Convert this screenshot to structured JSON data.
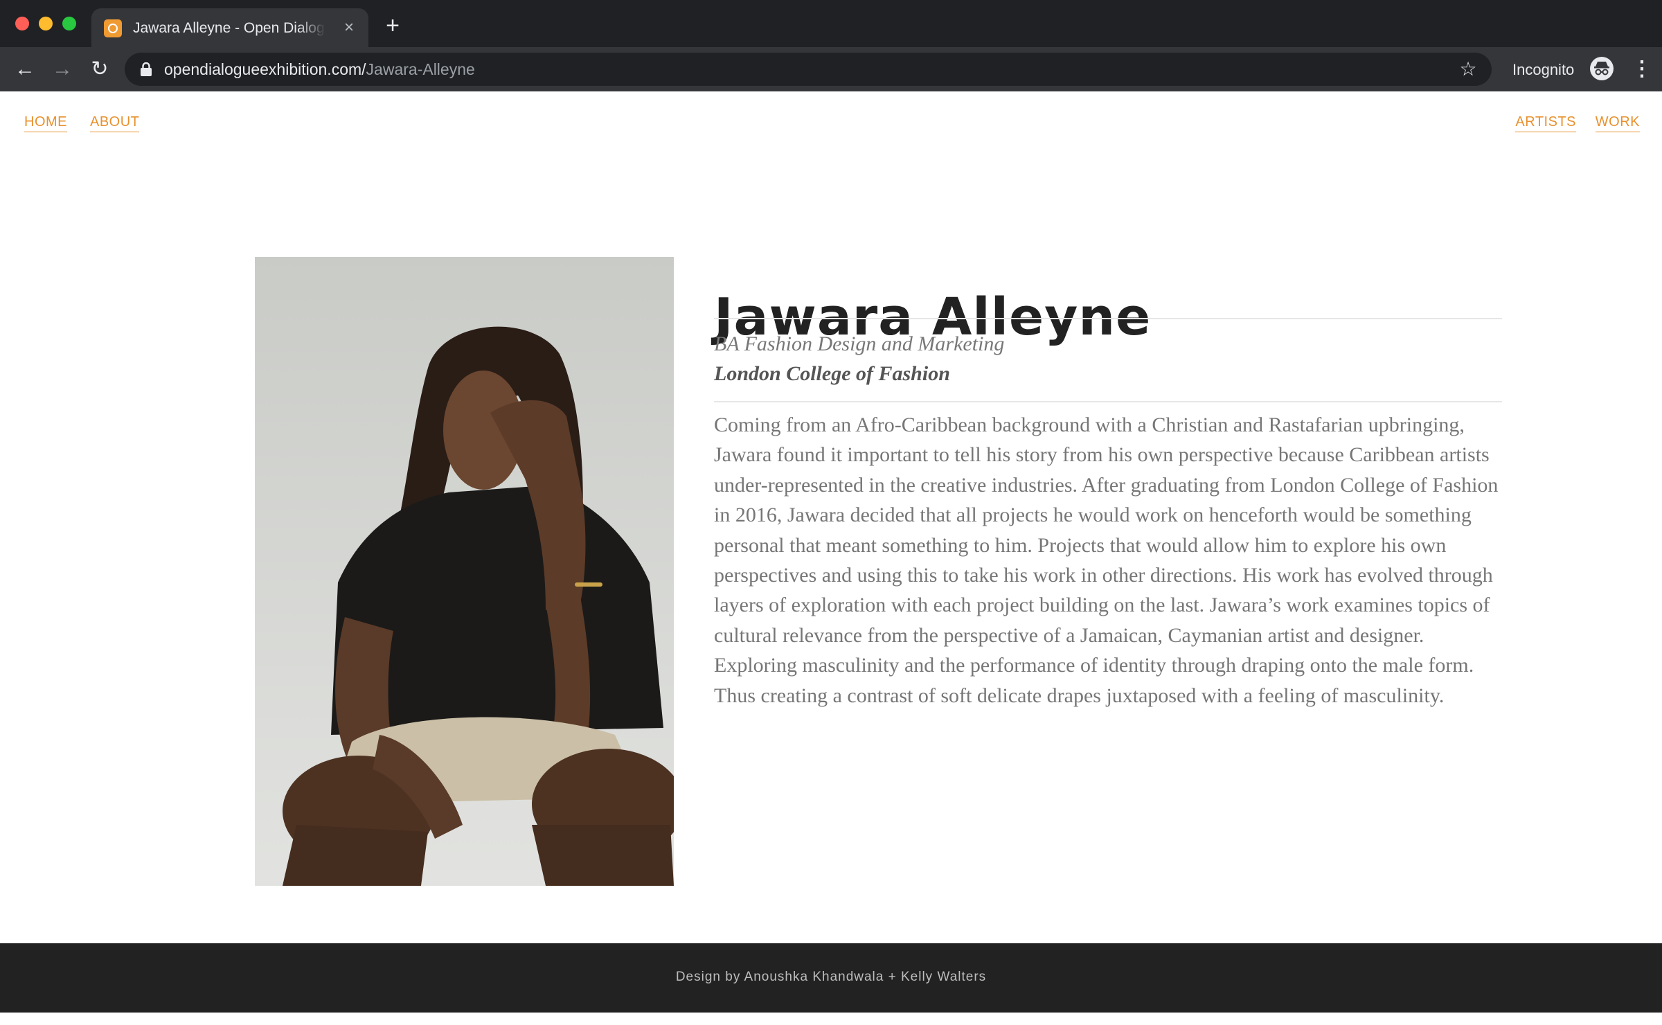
{
  "browser": {
    "tab_title": "Jawara Alleyne - Open Dialogue Exhibition",
    "tab_close_glyph": "×",
    "new_tab_glyph": "+",
    "url_host": "opendialogueexhibition.com/",
    "url_path": "Jawara-Alleyne",
    "incognito_label": "Incognito",
    "back_glyph": "←",
    "forward_glyph": "→",
    "reload_glyph": "↻",
    "star_glyph": "☆",
    "menu_glyph": "⋮",
    "icons": [
      "favicon-icon",
      "lock-icon",
      "bookmark-star-icon",
      "incognito-icon",
      "more-menu-icon"
    ]
  },
  "site_nav": {
    "left": [
      {
        "label": "HOME"
      },
      {
        "label": "ABOUT"
      }
    ],
    "right": [
      {
        "label": "ARTISTS"
      },
      {
        "label": "WORK"
      }
    ]
  },
  "artist": {
    "name": "Jawara Alleyne",
    "degree": "BA Fashion Design and Marketing",
    "college": "London College of Fashion",
    "bio": "Coming from an Afro-Caribbean background with a Christian and Rastafarian upbringing, Jawara found it important to tell his story from his own perspective because Caribbean artists under-represented in the creative industries. After graduating from London College of Fashion in 2016, Jawara decided that all projects he would work on henceforth would be something personal that meant something to him. Projects that would allow him to explore his own perspectives and using this to take his work in other directions. His work has evolved through layers of exploration with each project building on the last. Jawara’s work examines topics of cultural relevance from the perspective of a Jamaican, Caymanian artist and designer. Exploring masculinity and the performance of identity through draping onto the male form. Thus creating a contrast of soft delicate drapes juxtaposed with a feeling of masculinity."
  },
  "footer": {
    "credit": "Design by Anoushka Khandwala + Kelly Walters"
  },
  "colors": {
    "accent": "#e8912e",
    "browser_frame": "#202124",
    "toolbar": "#35363a",
    "footer_bg": "#222222",
    "heading": "#222222",
    "body_text": "#767676"
  }
}
